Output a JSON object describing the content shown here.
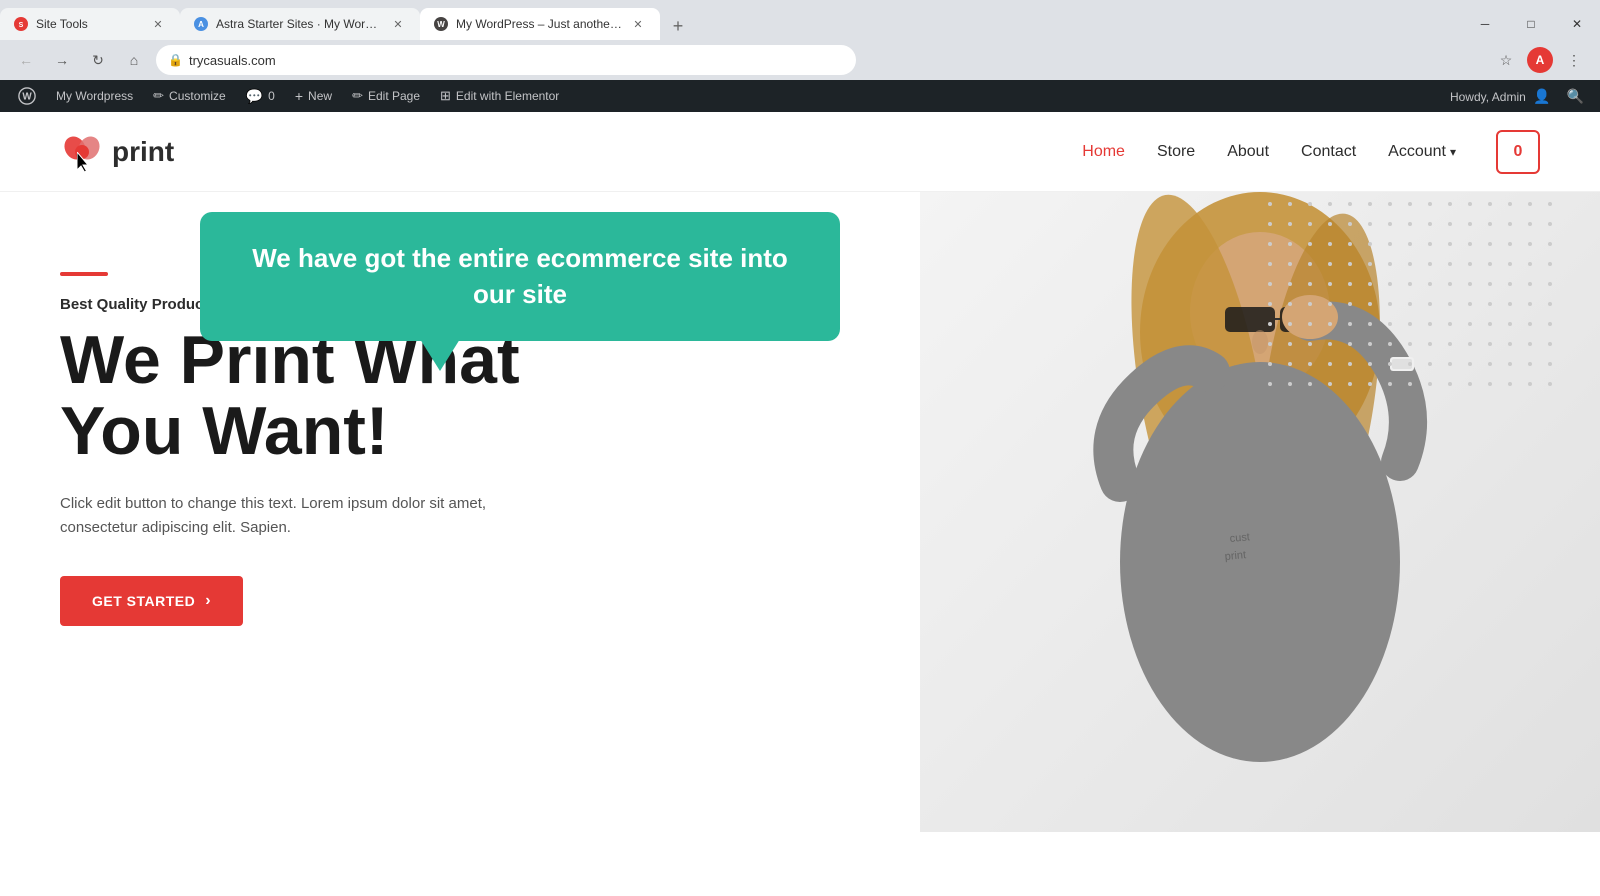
{
  "browser": {
    "tabs": [
      {
        "id": "tab1",
        "title": "Site Tools",
        "favicon": "S",
        "active": false
      },
      {
        "id": "tab2",
        "title": "Astra Starter Sites · My Wordpre...",
        "favicon": "A",
        "active": false
      },
      {
        "id": "tab3",
        "title": "My WordPress – Just another W...",
        "favicon": "W",
        "active": true
      }
    ],
    "url": "trycasuals.com",
    "window_controls": {
      "minimize": "─",
      "maximize": "□",
      "close": "✕"
    }
  },
  "wp_admin_bar": {
    "items": [
      {
        "id": "wp-logo",
        "label": "W",
        "is_logo": true
      },
      {
        "id": "my-wordpress",
        "label": "My Wordpress"
      },
      {
        "id": "customize",
        "label": "Customize"
      },
      {
        "id": "comments",
        "label": "0"
      },
      {
        "id": "new",
        "label": "New"
      },
      {
        "id": "edit-page",
        "label": "Edit Page"
      },
      {
        "id": "edit-elementor",
        "label": "Edit with Elementor"
      }
    ],
    "right": {
      "howdy": "Howdy, Admin",
      "search_icon": "🔍"
    }
  },
  "header": {
    "logo_text": "print",
    "nav": [
      {
        "id": "home",
        "label": "Home",
        "active": true
      },
      {
        "id": "store",
        "label": "Store",
        "active": false
      },
      {
        "id": "about",
        "label": "About",
        "active": false
      },
      {
        "id": "contact",
        "label": "Contact",
        "active": false
      },
      {
        "id": "account",
        "label": "Account",
        "active": false
      }
    ],
    "cart_count": "0"
  },
  "hero": {
    "speech_bubble": {
      "text": "We have got the entire ecommerce site into our site",
      "bg_color": "#2bb89a"
    },
    "divider_color": "#e53935",
    "subtitle": "Best Quality Products",
    "title_line1": "We Print What",
    "title_line2": "You Want!",
    "description": "Click edit button to change this text. Lorem ipsum dolor sit amet, consectetur adipiscing elit. Sapien.",
    "cta_label": "GET STARTED",
    "cta_arrow": "›"
  }
}
